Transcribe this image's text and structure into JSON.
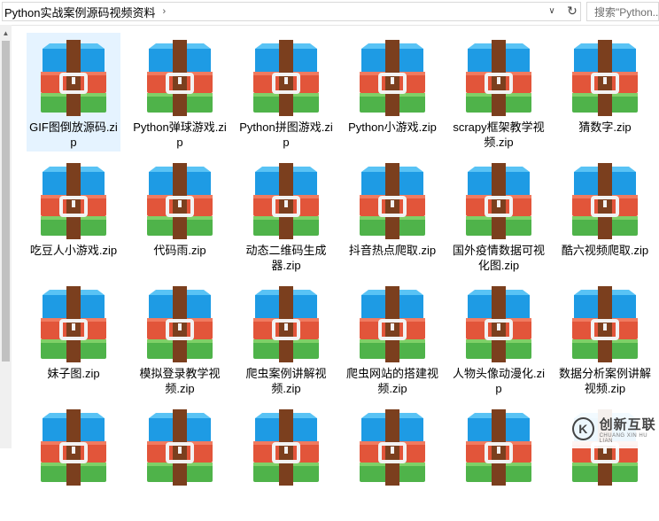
{
  "address_bar": {
    "path": "Python实战案例源码视频资料",
    "chevron": "›",
    "dropdown_glyph": "∨",
    "refresh_glyph": "↻"
  },
  "search": {
    "placeholder": "搜索\"Python..."
  },
  "icon": "winrar-archive-icon",
  "files": [
    {
      "name": "GIF图倒放源码.zip",
      "selected": true
    },
    {
      "name": "Python弹球游戏.zip"
    },
    {
      "name": "Python拼图游戏.zip"
    },
    {
      "name": "Python小游戏.zip"
    },
    {
      "name": "scrapy框架教学视频.zip"
    },
    {
      "name": "猜数字.zip"
    },
    {
      "name": "吃豆人小游戏.zip"
    },
    {
      "name": "代码雨.zip"
    },
    {
      "name": "动态二维码生成器.zip"
    },
    {
      "name": "抖音热点爬取.zip"
    },
    {
      "name": "国外疫情数据可视化图.zip"
    },
    {
      "name": "酷六视频爬取.zip"
    },
    {
      "name": "妹子图.zip"
    },
    {
      "name": "模拟登录教学视频.zip"
    },
    {
      "name": "爬虫案例讲解视频.zip"
    },
    {
      "name": "爬虫网站的搭建视频.zip"
    },
    {
      "name": "人物头像动漫化.zip"
    },
    {
      "name": "数据分析案例讲解视频.zip"
    },
    {
      "name": ""
    },
    {
      "name": ""
    },
    {
      "name": ""
    },
    {
      "name": ""
    },
    {
      "name": ""
    },
    {
      "name": ""
    }
  ],
  "watermark": {
    "logo_glyph": "K",
    "text": "创新互联",
    "sub": "CHUANG XIN HU LIAN"
  },
  "colors": {
    "selected_bg": "#e5f3ff",
    "book_blue": "#1e9be4",
    "book_red": "#e2553a",
    "book_green": "#4fb34a",
    "strap": "#7b3f1e",
    "buckle": "#f2f2f2"
  }
}
